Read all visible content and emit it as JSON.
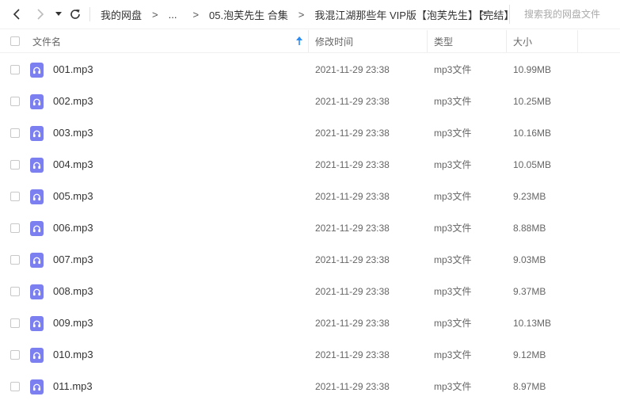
{
  "toolbar": {
    "back_icon": "chevron-left-icon",
    "forward_icon": "chevron-right-icon",
    "history_icon": "caret-down-icon",
    "refresh_icon": "refresh-icon",
    "breadcrumb": {
      "root": "我的网盘",
      "separator": ">",
      "ellipsis": "...",
      "folder1": "05.泡芙先生 合集",
      "folder2": "我混江湖那些年 VIP版【泡芙先生】【完结】",
      "more": ">"
    },
    "search_placeholder": "搜索我的网盘文件"
  },
  "header": {
    "name": "文件名",
    "modified": "修改时间",
    "type": "类型",
    "size": "大小",
    "sort_icon": "sort-up-arrow-icon"
  },
  "accent_color": "#7b7ff0",
  "sort_color": "#2b8cf3",
  "files": [
    {
      "name": "001.mp3",
      "modified": "2021-11-29 23:38",
      "type": "mp3文件",
      "size": "10.99MB"
    },
    {
      "name": "002.mp3",
      "modified": "2021-11-29 23:38",
      "type": "mp3文件",
      "size": "10.25MB"
    },
    {
      "name": "003.mp3",
      "modified": "2021-11-29 23:38",
      "type": "mp3文件",
      "size": "10.16MB"
    },
    {
      "name": "004.mp3",
      "modified": "2021-11-29 23:38",
      "type": "mp3文件",
      "size": "10.05MB"
    },
    {
      "name": "005.mp3",
      "modified": "2021-11-29 23:38",
      "type": "mp3文件",
      "size": "9.23MB"
    },
    {
      "name": "006.mp3",
      "modified": "2021-11-29 23:38",
      "type": "mp3文件",
      "size": "8.88MB"
    },
    {
      "name": "007.mp3",
      "modified": "2021-11-29 23:38",
      "type": "mp3文件",
      "size": "9.03MB"
    },
    {
      "name": "008.mp3",
      "modified": "2021-11-29 23:38",
      "type": "mp3文件",
      "size": "9.37MB"
    },
    {
      "name": "009.mp3",
      "modified": "2021-11-29 23:38",
      "type": "mp3文件",
      "size": "10.13MB"
    },
    {
      "name": "010.mp3",
      "modified": "2021-11-29 23:38",
      "type": "mp3文件",
      "size": "9.12MB"
    },
    {
      "name": "011.mp3",
      "modified": "2021-11-29 23:38",
      "type": "mp3文件",
      "size": "8.97MB"
    }
  ]
}
